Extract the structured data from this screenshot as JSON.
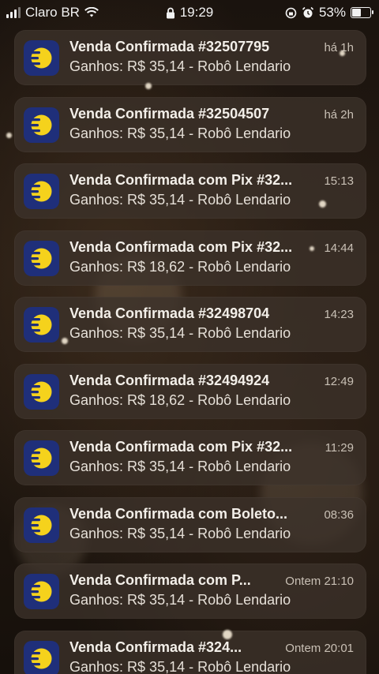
{
  "status_bar": {
    "carrier": "Claro BR",
    "time": "19:29",
    "battery": "53%",
    "battery_level": 0.53
  },
  "app": {
    "icon": "yellow-half-moon-logo-icon",
    "icon_bg": "#1f2f7a",
    "icon_fg": "#f5d21c"
  },
  "notifications": [
    {
      "title": "Venda Confirmada #32507795",
      "body": "Ganhos: R$ 35,14 - Robô  Lendario",
      "time": "há 1h"
    },
    {
      "title": "Venda Confirmada #32504507",
      "body": "Ganhos: R$ 35,14 - Robô  Lendario",
      "time": "há 2h"
    },
    {
      "title": "Venda Confirmada com Pix #32...",
      "body": "Ganhos: R$ 35,14 - Robô  Lendario",
      "time": "15:13"
    },
    {
      "title": "Venda Confirmada com Pix #32...",
      "body": "Ganhos: R$ 18,62 - Robô  Lendario",
      "time": "14:44"
    },
    {
      "title": "Venda Confirmada #32498704",
      "body": "Ganhos: R$ 35,14 - Robô  Lendario",
      "time": "14:23"
    },
    {
      "title": "Venda Confirmada #32494924",
      "body": "Ganhos: R$ 18,62 - Robô  Lendario",
      "time": "12:49"
    },
    {
      "title": "Venda Confirmada com Pix #32...",
      "body": "Ganhos: R$ 35,14 - Robô  Lendario",
      "time": "11:29"
    },
    {
      "title": "Venda Confirmada com Boleto...",
      "body": "Ganhos: R$ 35,14 - Robô  Lendario",
      "time": "08:36"
    },
    {
      "title": "Venda Confirmada com P...",
      "body": "Ganhos: R$ 35,14 - Robô  Lendario",
      "time": "Ontem 21:10"
    },
    {
      "title": "Venda Confirmada #324...",
      "body": "Ganhos: R$ 35,14 - Robô  Lendario",
      "time": "Ontem 20:01"
    }
  ]
}
